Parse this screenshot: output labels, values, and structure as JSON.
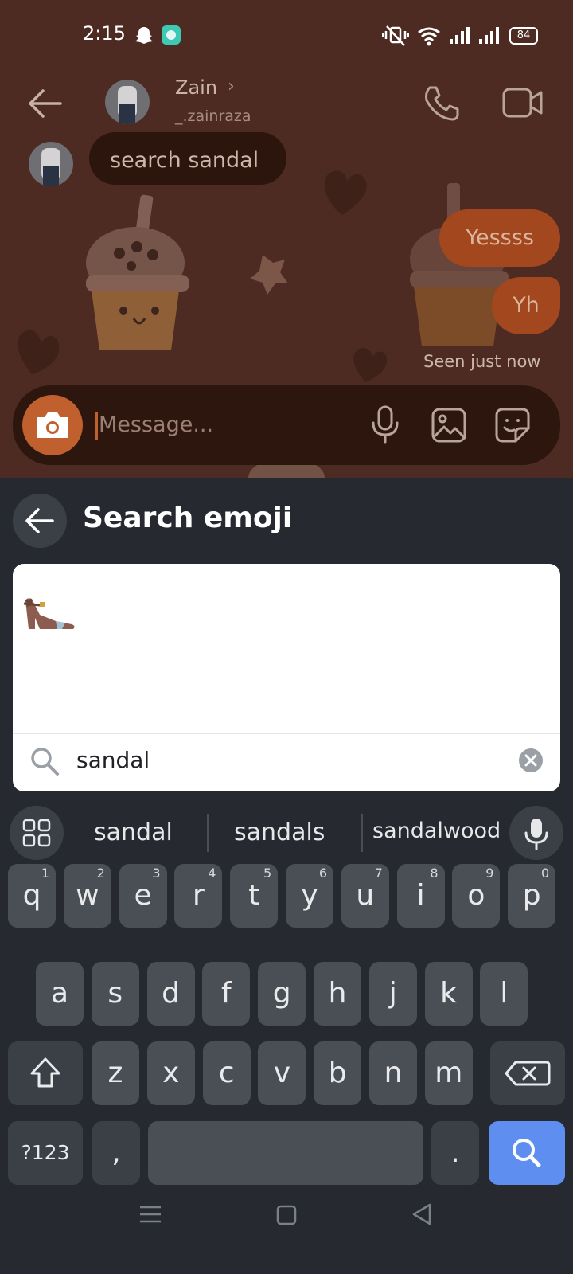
{
  "status_bar": {
    "time": "2:15",
    "battery": "84"
  },
  "header": {
    "name": "Zain",
    "username": "_.zainraza"
  },
  "messages": {
    "incoming": "search sandal",
    "outgoing_1": "Yessss",
    "outgoing_2": "Yh",
    "seen": "Seen just now"
  },
  "composer": {
    "placeholder": "Message..."
  },
  "emoji_search": {
    "title": "Search emoji",
    "query": "sandal",
    "result_emoji": "👡"
  },
  "suggestions": [
    "sandal",
    "sandals",
    "sandalwood"
  ],
  "keyboard": {
    "row1": [
      {
        "k": "q",
        "h": "1"
      },
      {
        "k": "w",
        "h": "2"
      },
      {
        "k": "e",
        "h": "3"
      },
      {
        "k": "r",
        "h": "4"
      },
      {
        "k": "t",
        "h": "5"
      },
      {
        "k": "y",
        "h": "6"
      },
      {
        "k": "u",
        "h": "7"
      },
      {
        "k": "i",
        "h": "8"
      },
      {
        "k": "o",
        "h": "9"
      },
      {
        "k": "p",
        "h": "0"
      }
    ],
    "row2": [
      "a",
      "s",
      "d",
      "f",
      "g",
      "h",
      "j",
      "k",
      "l"
    ],
    "row3": [
      "z",
      "x",
      "c",
      "v",
      "b",
      "n",
      "m"
    ],
    "symbols_label": "?123",
    "comma": ",",
    "period": "."
  },
  "colors": {
    "chat_bg": "#4d2b22",
    "outgoing_bubble": "#a3471e",
    "camera_button": "#c0602f",
    "panel_bg": "#262a30",
    "key_bg": "#4a4f56",
    "search_key": "#5e8ff0"
  }
}
